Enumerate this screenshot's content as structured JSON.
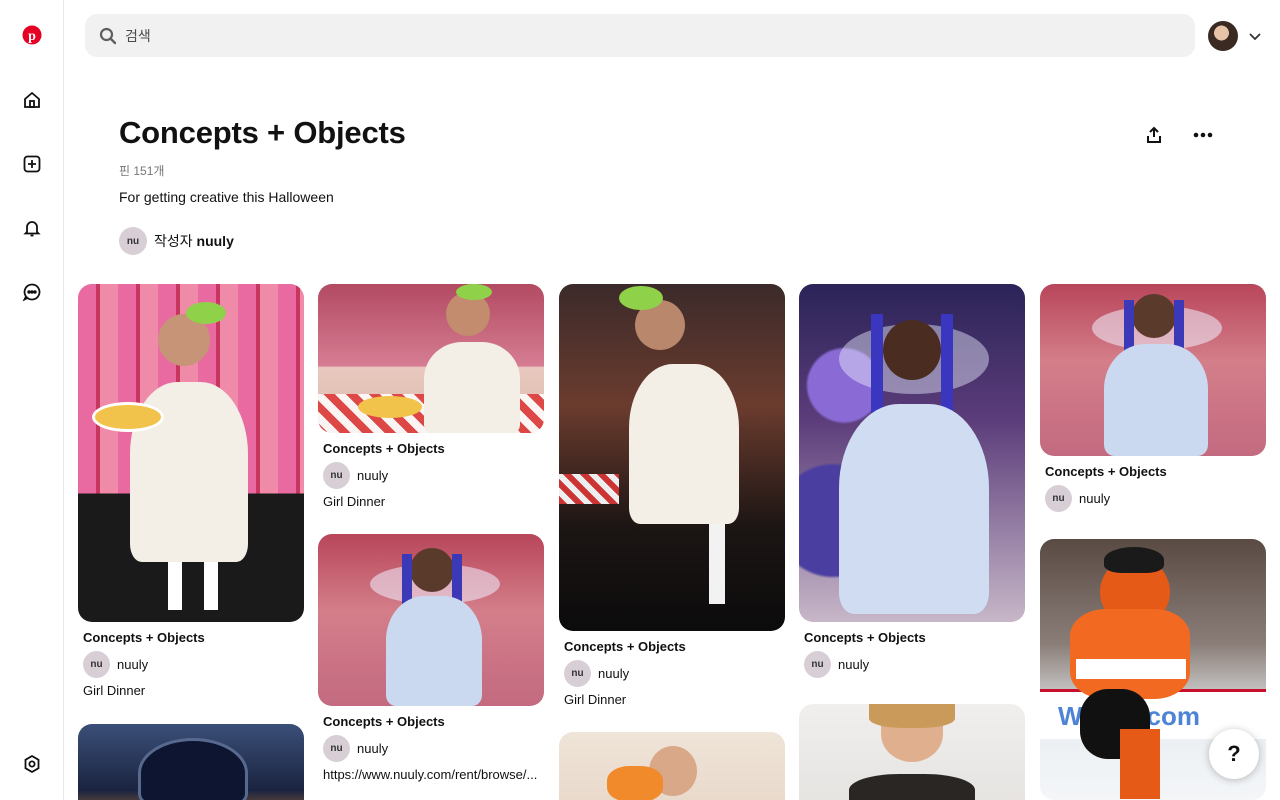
{
  "app": {
    "brand_color": "#e60023"
  },
  "search": {
    "placeholder": "검색",
    "value": ""
  },
  "board": {
    "title": "Concepts + Objects",
    "pin_count": "핀 151개",
    "description": "For getting creative this Halloween",
    "creator_prefix": "작성자",
    "creator_name": "nuuly",
    "creator_initials": "nu"
  },
  "pins": [
    {
      "board": "Concepts + Objects",
      "owner": "nuuly",
      "owner_initials": "nu",
      "title": "Girl Dinner"
    },
    {
      "board": "Concepts + Objects",
      "owner": "nuuly",
      "owner_initials": "nu",
      "title": "Girl Dinner"
    },
    {
      "board": "Concepts + Objects",
      "owner": "nuuly",
      "owner_initials": "nu",
      "title": "https://www.nuuly.com/rent/browse/..."
    },
    {
      "board": "Concepts + Objects",
      "owner": "nuuly",
      "owner_initials": "nu",
      "title": "Girl Dinner"
    },
    {
      "board": "Concepts + Objects",
      "owner": "nuuly",
      "owner_initials": "nu",
      "title": ""
    },
    {
      "board": "Concepts + Objects",
      "owner": "nuuly",
      "owner_initials": "nu",
      "title": ""
    }
  ],
  "help": {
    "label": "?"
  }
}
